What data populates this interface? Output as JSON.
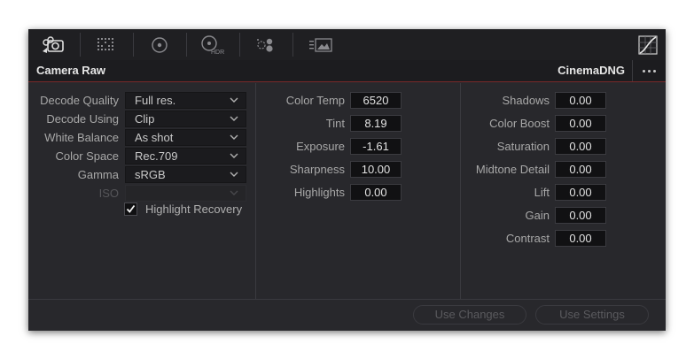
{
  "toolbar": {
    "icons": [
      "camera-raw-icon",
      "grid-icon",
      "circle-target-icon",
      "hdr-icon",
      "color-dots-icon",
      "image-adjust-icon",
      "curve-icon"
    ],
    "hdr_text": "HDR"
  },
  "header": {
    "title": "Camera Raw",
    "format": "CinemaDNG"
  },
  "decode": {
    "rows": [
      {
        "label": "Decode Quality",
        "value": "Full res."
      },
      {
        "label": "Decode Using",
        "value": "Clip"
      },
      {
        "label": "White Balance",
        "value": "As shot"
      },
      {
        "label": "Color Space",
        "value": "Rec.709"
      },
      {
        "label": "Gamma",
        "value": "sRGB"
      },
      {
        "label": "ISO",
        "value": ""
      }
    ],
    "highlight_recovery": {
      "label": "Highlight Recovery",
      "checked": true
    }
  },
  "color": {
    "rows": [
      {
        "label": "Color Temp",
        "value": "6520"
      },
      {
        "label": "Tint",
        "value": "8.19"
      },
      {
        "label": "Exposure",
        "value": "-1.61"
      },
      {
        "label": "Sharpness",
        "value": "10.00"
      },
      {
        "label": "Highlights",
        "value": "0.00"
      }
    ]
  },
  "tone": {
    "rows": [
      {
        "label": "Shadows",
        "value": "0.00"
      },
      {
        "label": "Color Boost",
        "value": "0.00"
      },
      {
        "label": "Saturation",
        "value": "0.00"
      },
      {
        "label": "Midtone Detail",
        "value": "0.00"
      },
      {
        "label": "Lift",
        "value": "0.00"
      },
      {
        "label": "Gain",
        "value": "0.00"
      },
      {
        "label": "Contrast",
        "value": "0.00"
      }
    ]
  },
  "footer": {
    "use_changes": "Use Changes",
    "use_settings": "Use Settings"
  },
  "colors": {
    "accent_line": "#7a2a2a",
    "panel_bg": "#28282c"
  }
}
